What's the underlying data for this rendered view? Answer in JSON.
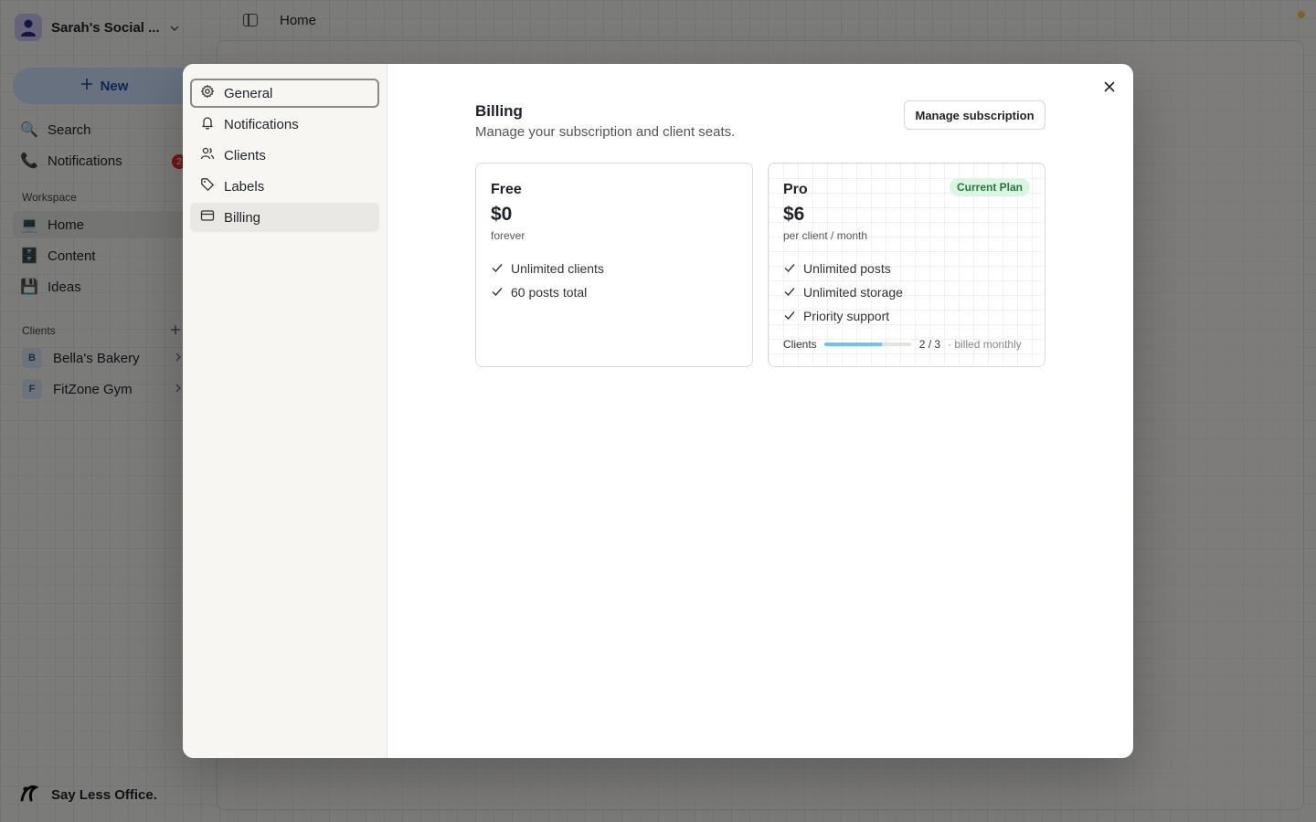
{
  "workspace": {
    "name": "Sarah's Social ..."
  },
  "sidebar": {
    "new_label": "New",
    "search_label": "Search",
    "notifications_label": "Notifications",
    "notifications_count": "2",
    "workspace_section": "Workspace",
    "workspace_items": [
      {
        "label": "Home",
        "emoji": "💻"
      },
      {
        "label": "Content",
        "emoji": "🗄️"
      },
      {
        "label": "Ideas",
        "emoji": "💾"
      }
    ],
    "clients_section": "Clients",
    "clients": [
      {
        "initial": "B",
        "label": "Bella's Bakery"
      },
      {
        "initial": "F",
        "label": "FitZone Gym"
      }
    ],
    "brand": "Say Less Office."
  },
  "topbar": {
    "breadcrumb": "Home"
  },
  "settings_nav": {
    "items": [
      {
        "label": "General",
        "icon": "gear-icon"
      },
      {
        "label": "Notifications",
        "icon": "bell-icon"
      },
      {
        "label": "Clients",
        "icon": "users-icon"
      },
      {
        "label": "Labels",
        "icon": "tag-icon"
      },
      {
        "label": "Billing",
        "icon": "credit-card-icon"
      }
    ],
    "active": "Billing"
  },
  "billing": {
    "title": "Billing",
    "subtitle": "Manage your subscription and client seats.",
    "manage_label": "Manage subscription",
    "plans": {
      "free": {
        "name": "Free",
        "price": "$0",
        "period": "forever",
        "features": [
          "Unlimited clients",
          "60 posts total"
        ]
      },
      "pro": {
        "name": "Pro",
        "price": "$6",
        "period": "per client / month",
        "badge": "Current Plan",
        "features": [
          "Unlimited posts",
          "Unlimited storage",
          "Priority support"
        ],
        "usage": {
          "label": "Clients",
          "used": 2,
          "total": 3,
          "count_text": "2 / 3",
          "note": "· billed monthly"
        }
      }
    }
  },
  "colors": {
    "accent": "#6ec4ef",
    "badge_bg": "#dcf5e3",
    "badge_text": "#1f7a3d",
    "notification_badge": "#e03131"
  }
}
